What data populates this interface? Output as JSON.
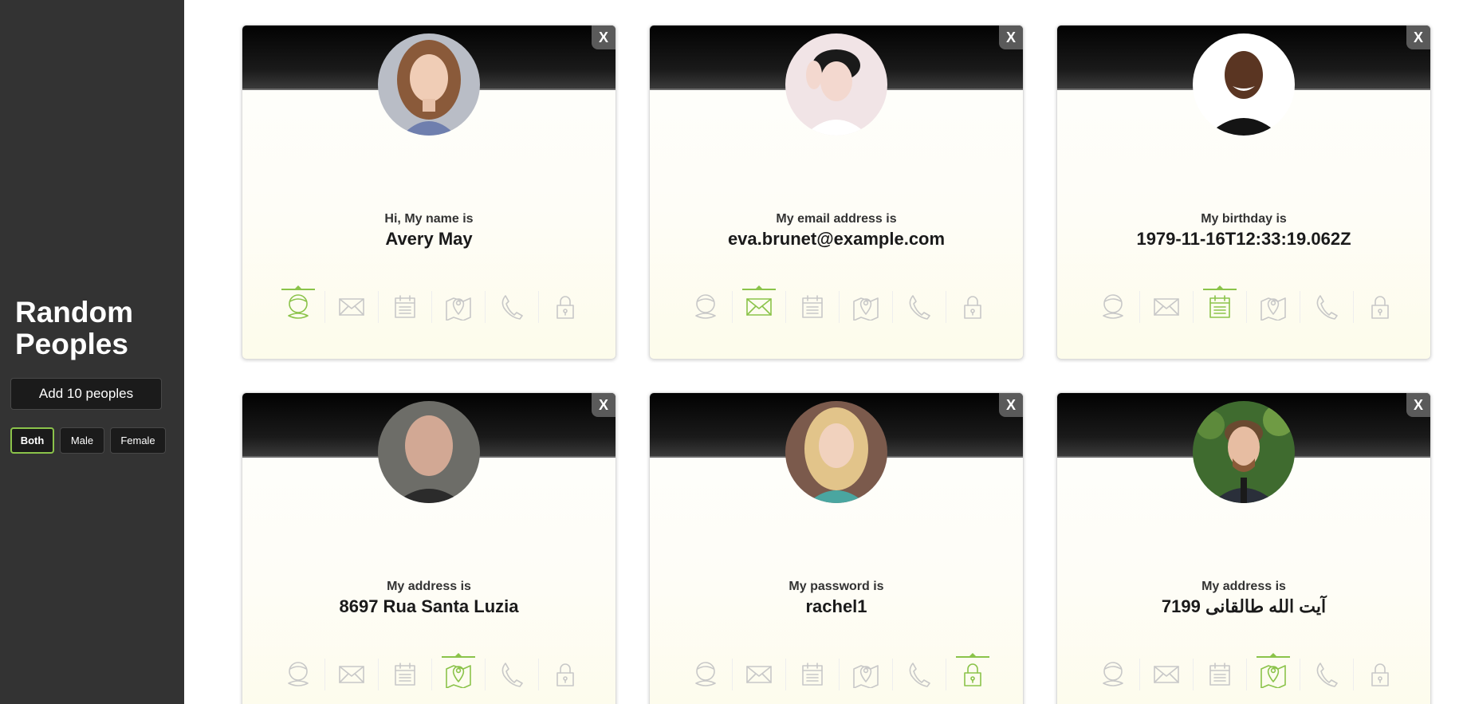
{
  "sidebar": {
    "title": "Random Peoples",
    "add_label": "Add 10 peoples",
    "filters": [
      "Both",
      "Male",
      "Female"
    ],
    "active_filter": "Both"
  },
  "colors": {
    "accent": "#8bc34a",
    "icon_inactive": "#c8c8c8",
    "sidebar_bg": "#333333"
  },
  "icons": [
    "person-icon",
    "envelope-icon",
    "calendar-icon",
    "map-pin-icon",
    "phone-icon",
    "lock-icon"
  ],
  "cards": [
    {
      "close": "X",
      "label": "Hi, My name is",
      "value": "Avery May",
      "active_icon": 0
    },
    {
      "close": "X",
      "label": "My email address is",
      "value": "eva.brunet@example.com",
      "active_icon": 1
    },
    {
      "close": "X",
      "label": "My birthday is",
      "value": "1979-11-16T12:33:19.062Z",
      "active_icon": 2
    },
    {
      "close": "X",
      "label": "My address is",
      "value": "8697 Rua Santa Luzia",
      "active_icon": 3
    },
    {
      "close": "X",
      "label": "My password is",
      "value": "rachel1",
      "active_icon": 5
    },
    {
      "close": "X",
      "label": "My address is",
      "value": "7199 آیت الله طالقانی",
      "active_icon": 3
    }
  ]
}
